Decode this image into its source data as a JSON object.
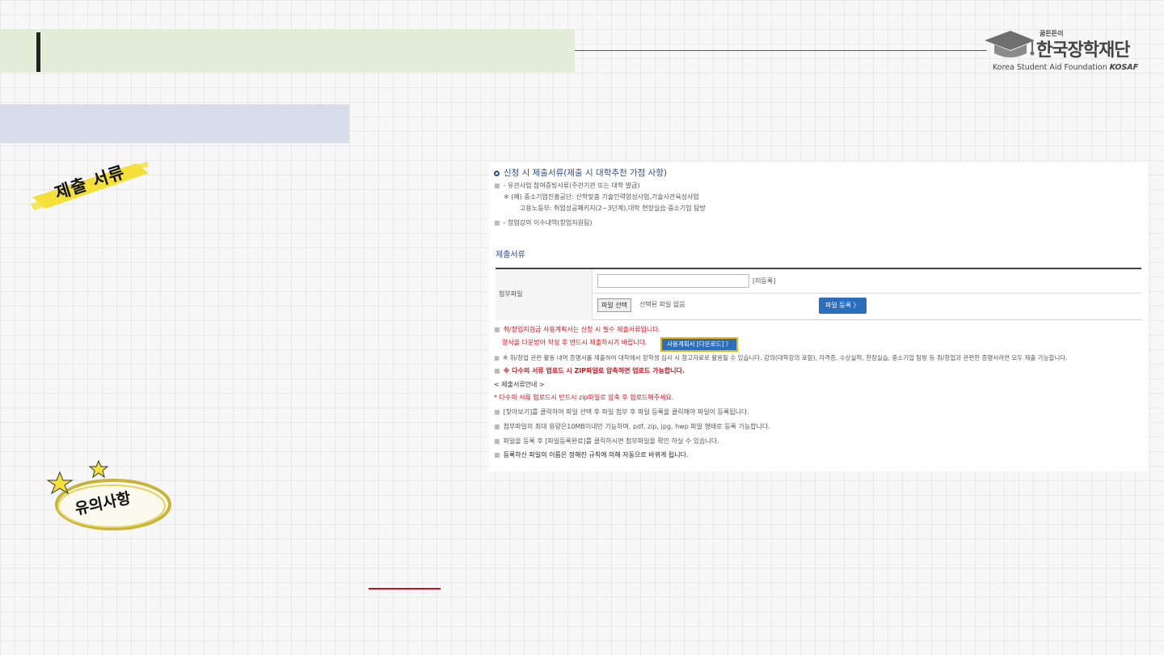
{
  "logo": {
    "tag": "꿈든든이",
    "name": "한국장학재단",
    "english": "Korea Student Aid Foundation",
    "english_abbr": "KOSAF"
  },
  "stickers": {
    "docs": "제출 서류",
    "caution": "유의사항"
  },
  "panel": {
    "section_title": "신청 시 제출서류(제출 시 대학추천 가점 사항)",
    "notes": [
      "- 유관사업 참여증빙서류(주관기관 또는 대학 발급)",
      "※ (예) 중소기업진흥공단: 산학맞춤 기술인력양성사업,기술사관육성사업",
      "고용노동부: 취업성공패키지(2~3단계),대학 현장실습·중소기업 탐방",
      "- 창업강의 이수내역(창업지원팀)"
    ],
    "docs_title": "제출서류",
    "table": {
      "label": "첨부파일",
      "unregistered": "[미등록]",
      "file_select": "파일 선택",
      "no_file": "선택된 파일 없음",
      "register": "파일 등록 〉"
    },
    "warn1": "취/창업지원금 사용계획서는 신청 시 필수 제출서류입니다.",
    "warn2": "양식을 다운받아 작성 후 반드시 제출하시기 바랍니다.",
    "download": "사용계획서 [다운로드] 〉",
    "note_long": "※ 취/창업 관련 활동 내역 증명서를 제출하여 대학에서 장학생 심사 시 참고자료로 활용될 수 있습니다. 강의(대학강의 포함), 자격증, 수상실적, 현장실습, 중소기업 탐방 등 취/창업과 관련한 증명서라면 모두 제출 가능합니다.",
    "zip_note": "※ 다수의 서류 업로드 시 ZIP파일로 압축하면 업로드 가능합니다.",
    "guide_title": "< 제출서류안내 >",
    "guide_red": "* 다수의 서류 업로드시 반드시 zip파일로 압축 후 업로드해주세요.",
    "guides": [
      "[찾아보기]를 클릭하여 파일 선택 후 파일 첨부 후 파일 등록을 클릭해야 파일이 등록됩니다.",
      "첨부파일의 최대 용량은10MB이내만 가능하며, pdf, zip, jpg, hwp 파일 형태로 등록 가능합니다.",
      "파일을 등록 후 [파일등록완료]를 클릭하시면 첨부파일을 확인 하실 수 있습니다."
    ],
    "guide_last": "등록하신 파일의 이름은 정해진 규칙에 의해 자동으로 바뀌게 됩니다."
  },
  "colors": {
    "header_band": "#e2ecd8",
    "subtitle_band": "#d6dde9",
    "accent_blue": "#2a6ebd",
    "warn_red": "#d2161e",
    "highlight_yellow": "#f0b400"
  }
}
